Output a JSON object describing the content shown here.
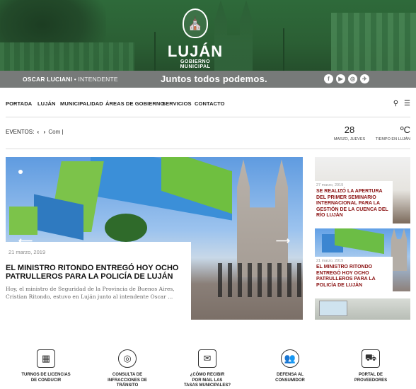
{
  "header": {
    "logo_name": "LUJÁN",
    "logo_sub": "GOBIERNO MUNICIPAL",
    "mayor_name": "OSCAR LUCIANI",
    "mayor_role": "INTENDENTE",
    "slogan": "Juntos todos podemos.",
    "social": [
      "f",
      "▶",
      "◎",
      "✈"
    ]
  },
  "nav": {
    "items": [
      "PORTADA",
      "LUJÁN",
      "MUNICIPALIDAD",
      "ÁREAS DE GOBIERNO",
      "SERVICIOS",
      "CONTACTO"
    ],
    "search_icon": "search-icon",
    "menu_icon": "hamburger-menu-icon"
  },
  "eventos": {
    "label": "EVENTOS:",
    "prev": "‹",
    "next": "›",
    "text": "Com"
  },
  "date": {
    "day": "28",
    "label": "MARZO, JUEVES"
  },
  "weather": {
    "value": "ºC",
    "label": "TIEMPO EN LUJÁN"
  },
  "feature": {
    "date": "21 marzo, 2019",
    "title": "EL MINISTRO RITONDO ENTREGÓ HOY OCHO PATRULLEROS PARA LA POLICÍA DE LUJÁN",
    "excerpt": "Hoy, el ministro de Seguridad de la Provincia de Buenos Aires, Cristian Ritondo, estuvo en Luján junto al intendente Oscar ...",
    "prev_arrow": "⟵",
    "next_arrow": "⟶"
  },
  "side_news": [
    {
      "date": "27 marzo, 2019",
      "title": "SE REALIZÓ LA APERTURA DEL PRIMER SEMINARIO INTERNACIONAL PARA LA GESTIÓN DE LA CUENCA DEL RÍO LUJÁN"
    },
    {
      "date": "21 marzo, 2019",
      "title": "EL MINISTRO RITONDO ENTREGÓ HOY OCHO PATRULLEROS PARA LA POLICÍA DE LUJÁN"
    }
  ],
  "quick_links": [
    {
      "label1": "TURNOS DE LICENCIAS",
      "label2": "DE CONDUCIR",
      "label3": "",
      "icon": "license-calendar-icon",
      "glyph": "▦"
    },
    {
      "label1": "CONSULTA DE",
      "label2": "INFRACCIONES DE",
      "label3": "TRÁNSITO",
      "icon": "steering-wheel-icon",
      "glyph": "◎"
    },
    {
      "label1": "¿CÓMO RECIBIR",
      "label2": "POR MAIL LAS",
      "label3": "TASAS MUNICIPALES?",
      "icon": "mail-icon",
      "glyph": "✉"
    },
    {
      "label1": "DEFENSA AL",
      "label2": "CONSUMIDOR",
      "label3": "",
      "icon": "people-group-icon",
      "glyph": "👥"
    },
    {
      "label1": "PORTAL DE",
      "label2": "PROVEEDORES",
      "label3": "",
      "icon": "hand-truck-icon",
      "glyph": "⛟"
    }
  ],
  "colors": {
    "header_green": "#2e6a3a",
    "strip_grey": "#777a79",
    "side_title_red": "#8a1010"
  }
}
